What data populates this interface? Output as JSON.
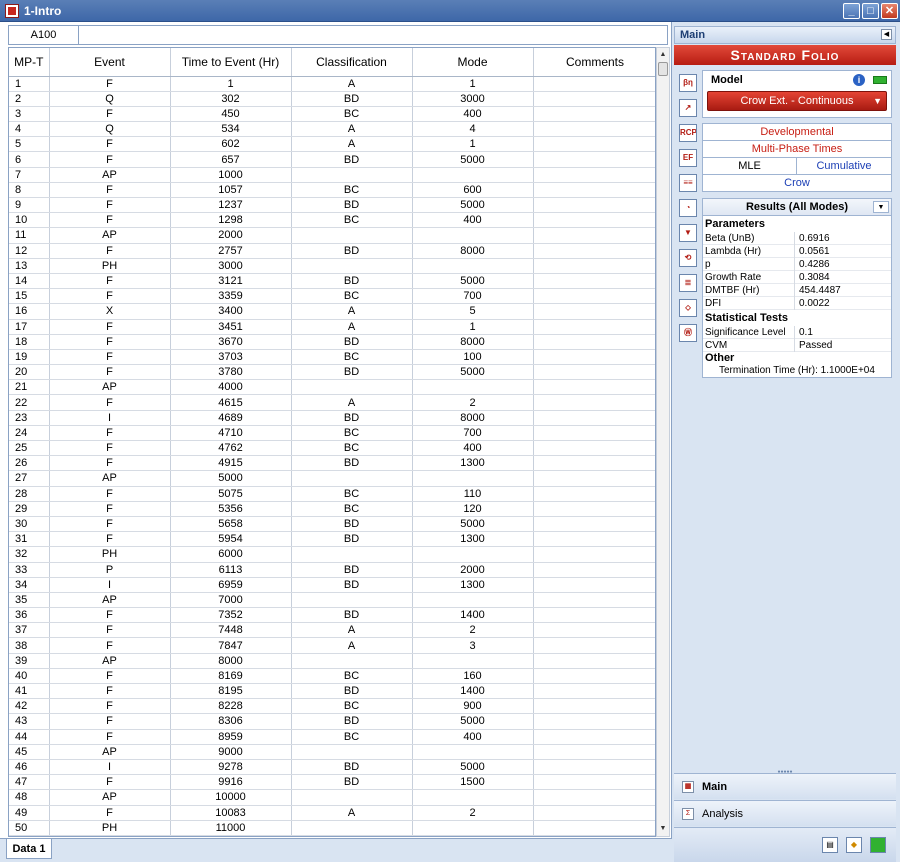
{
  "window": {
    "title": "1-Intro",
    "minimize_glyph": "_",
    "maximize_glyph": "□",
    "close_glyph": "✕"
  },
  "formula_bar": {
    "cell_ref": "A100",
    "value": ""
  },
  "grid": {
    "headers": [
      "MP-T",
      "Event",
      "Time to Event (Hr)",
      "Classification",
      "Mode",
      "Comments"
    ],
    "rows": [
      [
        "1",
        "F",
        "1",
        "A",
        "1",
        ""
      ],
      [
        "2",
        "Q",
        "302",
        "BD",
        "3000",
        ""
      ],
      [
        "3",
        "F",
        "450",
        "BC",
        "400",
        ""
      ],
      [
        "4",
        "Q",
        "534",
        "A",
        "4",
        ""
      ],
      [
        "5",
        "F",
        "602",
        "A",
        "1",
        ""
      ],
      [
        "6",
        "F",
        "657",
        "BD",
        "5000",
        ""
      ],
      [
        "7",
        "AP",
        "1000",
        "",
        "",
        ""
      ],
      [
        "8",
        "F",
        "1057",
        "BC",
        "600",
        ""
      ],
      [
        "9",
        "F",
        "1237",
        "BD",
        "5000",
        ""
      ],
      [
        "10",
        "F",
        "1298",
        "BC",
        "400",
        ""
      ],
      [
        "11",
        "AP",
        "2000",
        "",
        "",
        ""
      ],
      [
        "12",
        "F",
        "2757",
        "BD",
        "8000",
        ""
      ],
      [
        "13",
        "PH",
        "3000",
        "",
        "",
        ""
      ],
      [
        "14",
        "F",
        "3121",
        "BD",
        "5000",
        ""
      ],
      [
        "15",
        "F",
        "3359",
        "BC",
        "700",
        ""
      ],
      [
        "16",
        "X",
        "3400",
        "A",
        "5",
        ""
      ],
      [
        "17",
        "F",
        "3451",
        "A",
        "1",
        ""
      ],
      [
        "18",
        "F",
        "3670",
        "BD",
        "8000",
        ""
      ],
      [
        "19",
        "F",
        "3703",
        "BC",
        "100",
        ""
      ],
      [
        "20",
        "F",
        "3780",
        "BD",
        "5000",
        ""
      ],
      [
        "21",
        "AP",
        "4000",
        "",
        "",
        ""
      ],
      [
        "22",
        "F",
        "4615",
        "A",
        "2",
        ""
      ],
      [
        "23",
        "I",
        "4689",
        "BD",
        "8000",
        ""
      ],
      [
        "24",
        "F",
        "4710",
        "BC",
        "700",
        ""
      ],
      [
        "25",
        "F",
        "4762",
        "BC",
        "400",
        ""
      ],
      [
        "26",
        "F",
        "4915",
        "BD",
        "1300",
        ""
      ],
      [
        "27",
        "AP",
        "5000",
        "",
        "",
        ""
      ],
      [
        "28",
        "F",
        "5075",
        "BC",
        "110",
        ""
      ],
      [
        "29",
        "F",
        "5356",
        "BC",
        "120",
        ""
      ],
      [
        "30",
        "F",
        "5658",
        "BD",
        "5000",
        ""
      ],
      [
        "31",
        "F",
        "5954",
        "BD",
        "1300",
        ""
      ],
      [
        "32",
        "PH",
        "6000",
        "",
        "",
        ""
      ],
      [
        "33",
        "P",
        "6113",
        "BD",
        "2000",
        ""
      ],
      [
        "34",
        "I",
        "6959",
        "BD",
        "1300",
        ""
      ],
      [
        "35",
        "AP",
        "7000",
        "",
        "",
        ""
      ],
      [
        "36",
        "F",
        "7352",
        "BD",
        "1400",
        ""
      ],
      [
        "37",
        "F",
        "7448",
        "A",
        "2",
        ""
      ],
      [
        "38",
        "F",
        "7847",
        "A",
        "3",
        ""
      ],
      [
        "39",
        "AP",
        "8000",
        "",
        "",
        ""
      ],
      [
        "40",
        "F",
        "8169",
        "BC",
        "160",
        ""
      ],
      [
        "41",
        "F",
        "8195",
        "BD",
        "1400",
        ""
      ],
      [
        "42",
        "F",
        "8228",
        "BC",
        "900",
        ""
      ],
      [
        "43",
        "F",
        "8306",
        "BD",
        "5000",
        ""
      ],
      [
        "44",
        "F",
        "8959",
        "BC",
        "400",
        ""
      ],
      [
        "45",
        "AP",
        "9000",
        "",
        "",
        ""
      ],
      [
        "46",
        "I",
        "9278",
        "BD",
        "5000",
        ""
      ],
      [
        "47",
        "F",
        "9916",
        "BD",
        "1500",
        ""
      ],
      [
        "48",
        "AP",
        "10000",
        "",
        "",
        ""
      ],
      [
        "49",
        "F",
        "10083",
        "A",
        "2",
        ""
      ],
      [
        "50",
        "PH",
        "11000",
        "",
        "",
        ""
      ]
    ]
  },
  "sheet_tabs": [
    "Data 1"
  ],
  "panel": {
    "header": "Main",
    "folio_title": "Standard Folio",
    "model": {
      "title": "Model",
      "info_glyph": "i",
      "selected": "Crow Ext. - Continuous",
      "chevron": "▼"
    },
    "options": {
      "developmental": "Developmental",
      "multiphase": "Multi-Phase Times",
      "mle": "MLE",
      "cumulative": "Cumulative",
      "crow": "Crow"
    },
    "results": {
      "title": "Results (All Modes)",
      "sections": {
        "parameters": "Parameters",
        "statistical_tests": "Statistical Tests",
        "other": "Other"
      },
      "params": [
        {
          "label": "Beta (UnB)",
          "value": "0.6916"
        },
        {
          "label": "Lambda (Hr)",
          "value": "0.0561"
        },
        {
          "label": "p",
          "value": "0.4286"
        },
        {
          "label": "Growth Rate",
          "value": "0.3084"
        },
        {
          "label": "DMTBF (Hr)",
          "value": "454.4487"
        },
        {
          "label": "DFI",
          "value": "0.0022"
        }
      ],
      "tests": [
        {
          "label": "Significance Level",
          "value": "0.1"
        },
        {
          "label": "CVM",
          "value": "Passed"
        }
      ],
      "termination": "Termination Time (Hr): 1.1000E+04"
    },
    "tool_icons": [
      "βη σμ",
      "↗",
      "RCP",
      "EF",
      "≡≡",
      "◔",
      "▼",
      "⟲",
      "≣",
      "⬦",
      "Ⓦ"
    ],
    "nav": {
      "main": "Main",
      "analysis": "Analysis"
    }
  }
}
